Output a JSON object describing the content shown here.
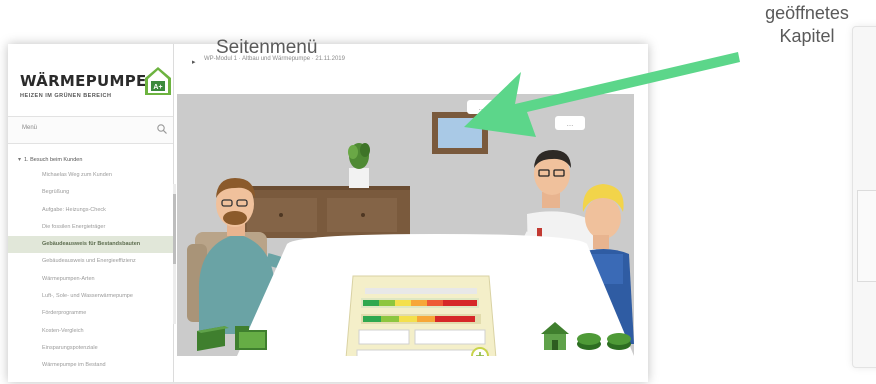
{
  "annotations": {
    "side_menu_label": "Seitenmenü",
    "open_chapter_line1": "geöffnetes",
    "open_chapter_line2": "Kapitel",
    "arrow_color": "#5cd68a"
  },
  "sidebar": {
    "logo_title": "WÄRMEPUMPE",
    "logo_subtitle": "HEIZEN IM GRÜNEN BEREICH",
    "logo_badge": "A+",
    "search_label": "Menü",
    "search_icon": "search-icon",
    "chapter": "1. Besuch beim Kunden",
    "items": [
      "Michaelas Weg zum Kunden",
      "Begrüßung",
      "Aufgabe: Heizungs-Check",
      "Die fossilen Energieträger",
      "Gebäudeausweis für Bestandsbauten",
      "Gebäudeausweis und Energieeffizienz",
      "Wärmepumpen-Arten",
      "Luft-, Sole- und Wasserwärmepumpe",
      "Förderprogramme",
      "Kosten-Vergleich",
      "Einsparungspotenziale",
      "Wärmepumpe im Bestand"
    ],
    "active_index": 4
  },
  "topbar": {
    "back_icon": "chevron-left-icon",
    "title": "WP-Modul 1 · Altbau und Wärmepumpe · 21.11.2019"
  },
  "scene": {
    "speech_left": "…",
    "speech_right": "…",
    "toolbar_left": [
      "book-icon",
      "folder-icon"
    ],
    "toolbar_right": [
      "house-icon",
      "stack-icon",
      "stack-icon"
    ],
    "zoom_icon": "zoom-icon",
    "colors": {
      "table": "#ffffff",
      "wall": "#c9c9c9",
      "sideboard": "#7a5a3d",
      "accent": "#8ab83f"
    }
  }
}
